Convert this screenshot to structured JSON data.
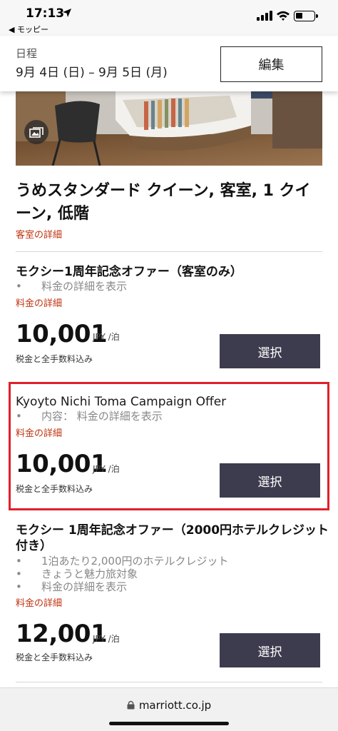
{
  "status_bar": {
    "time": "17:13",
    "back_app": "◀ モッピー"
  },
  "date_header": {
    "label": "日程",
    "dates": "9月 4日 (日) – 9月 5日 (月)",
    "edit_label": "編集"
  },
  "room": {
    "title": "うめスタンダード クイーン, 客室, 1 クイーン, 低階",
    "details_link": "客室の詳細"
  },
  "offers": [
    {
      "name": "モクシー1周年記念オファー（客室のみ）",
      "bullets": [
        "料金の詳細を表示"
      ],
      "details_link": "料金の詳細",
      "price": "10,001",
      "unit": "JPY /泊",
      "tax_note": "税金と全手数料込み",
      "select_label": "選択"
    },
    {
      "name": "Kyoyto Nichi Toma Campaign Offer",
      "bullets": [
        "内容： 料金の詳細を表示"
      ],
      "details_link": "料金の詳細",
      "price": "10,001",
      "unit": "JPY /泊",
      "tax_note": "税金と全手数料込み",
      "select_label": "選択"
    },
    {
      "name": "モクシー 1周年記念オファー（2000円ホテルクレジット付き）",
      "bullets": [
        "1泊あたり2,000円のホテルクレジット",
        "きょうと魅力旅対象",
        "料金の詳細を表示"
      ],
      "details_link": "料金の詳細",
      "price": "12,001",
      "unit": "JPY /泊",
      "tax_note": "税金と全手数料込み",
      "select_label": "選択"
    }
  ],
  "browser": {
    "url": "marriott.co.jp"
  },
  "colors": {
    "accent_red": "#c0330f",
    "button_dark": "#3d3b4e",
    "highlight": "#e0202a"
  }
}
